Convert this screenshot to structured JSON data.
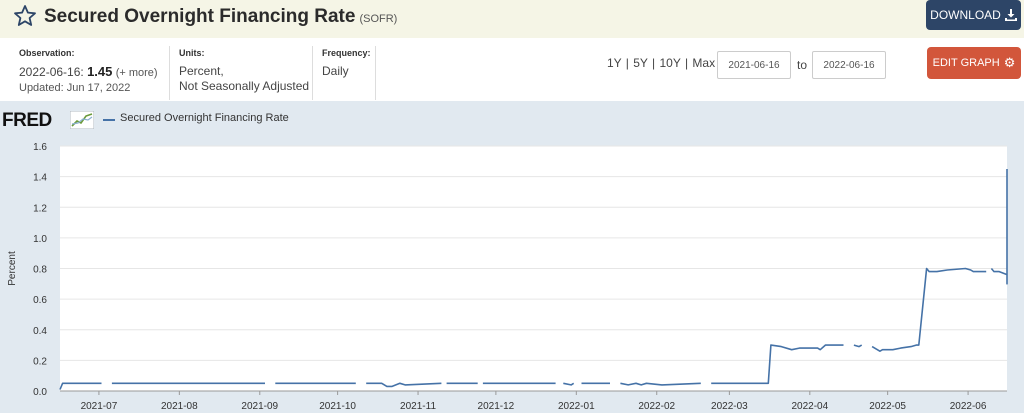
{
  "header": {
    "title": "Secured Overnight Financing Rate",
    "series_id": "(SOFR)",
    "download_label": "DOWNLOAD"
  },
  "info": {
    "observation_label": "Observation:",
    "observation_date": "2022-06-16:",
    "observation_value": "1.45",
    "observation_more": "(+ more)",
    "updated": "Updated: Jun 17, 2022",
    "units_label": "Units:",
    "units_line1": "Percent,",
    "units_line2": "Not Seasonally Adjusted",
    "frequency_label": "Frequency:",
    "frequency_value": "Daily"
  },
  "controls": {
    "ranges": "1Y | 5Y | 10Y | Max",
    "start_date": "2021-06-16",
    "to_label": "to",
    "end_date": "2022-06-16",
    "edit_label": "EDIT GRAPH"
  },
  "logo": {
    "text": "FRED"
  },
  "chart_data": {
    "type": "line",
    "legend": [
      "Secured Overnight Financing Rate"
    ],
    "ylabel": "Percent",
    "ylim": [
      0,
      1.6
    ],
    "yticks": [
      "0.0",
      "0.2",
      "0.4",
      "0.6",
      "0.8",
      "1.0",
      "1.2",
      "1.4",
      "1.6"
    ],
    "xlim": [
      "2021-06-16",
      "2022-06-16"
    ],
    "xticks": [
      {
        "date": "2021-07-01",
        "label": "2021-07"
      },
      {
        "date": "2021-08-01",
        "label": "2021-08"
      },
      {
        "date": "2021-09-01",
        "label": "2021-09"
      },
      {
        "date": "2021-10-01",
        "label": "2021-10"
      },
      {
        "date": "2021-11-01",
        "label": "2021-11"
      },
      {
        "date": "2021-12-01",
        "label": "2021-12"
      },
      {
        "date": "2022-01-01",
        "label": "2022-01"
      },
      {
        "date": "2022-02-01",
        "label": "2022-02"
      },
      {
        "date": "2022-03-01",
        "label": "2022-03"
      },
      {
        "date": "2022-04-01",
        "label": "2022-04"
      },
      {
        "date": "2022-05-01",
        "label": "2022-05"
      },
      {
        "date": "2022-06-01",
        "label": "2022-06"
      }
    ],
    "grid": true,
    "series_color": "#4572a7",
    "series": [
      {
        "name": "Secured Overnight Financing Rate",
        "segments": [
          [
            [
              "2021-06-16",
              0.01
            ],
            [
              "2021-06-17",
              0.05
            ],
            [
              "2021-07-02",
              0.05
            ]
          ],
          [
            [
              "2021-07-06",
              0.05
            ],
            [
              "2021-09-03",
              0.05
            ]
          ],
          [
            [
              "2021-09-07",
              0.05
            ],
            [
              "2021-10-08",
              0.05
            ]
          ],
          [
            [
              "2021-10-12",
              0.05
            ],
            [
              "2021-10-18",
              0.05
            ],
            [
              "2021-10-20",
              0.03
            ],
            [
              "2021-10-22",
              0.03
            ],
            [
              "2021-10-25",
              0.05
            ],
            [
              "2021-10-27",
              0.04
            ],
            [
              "2021-11-10",
              0.05
            ]
          ],
          [
            [
              "2021-11-12",
              0.05
            ],
            [
              "2021-11-24",
              0.05
            ]
          ],
          [
            [
              "2021-11-26",
              0.05
            ],
            [
              "2021-12-24",
              0.05
            ]
          ],
          [
            [
              "2021-12-27",
              0.05
            ],
            [
              "2021-12-30",
              0.04
            ],
            [
              "2021-12-31",
              0.05
            ]
          ],
          [
            [
              "2022-01-03",
              0.05
            ],
            [
              "2022-01-14",
              0.05
            ]
          ],
          [
            [
              "2022-01-18",
              0.05
            ],
            [
              "2022-01-21",
              0.04
            ],
            [
              "2022-01-24",
              0.05
            ],
            [
              "2022-01-26",
              0.04
            ],
            [
              "2022-01-28",
              0.05
            ],
            [
              "2022-02-03",
              0.04
            ],
            [
              "2022-02-18",
              0.05
            ]
          ],
          [
            [
              "2022-02-22",
              0.05
            ],
            [
              "2022-03-16",
              0.05
            ],
            [
              "2022-03-17",
              0.3
            ],
            [
              "2022-03-21",
              0.29
            ],
            [
              "2022-03-25",
              0.27
            ],
            [
              "2022-03-28",
              0.28
            ],
            [
              "2022-04-04",
              0.28
            ],
            [
              "2022-04-05",
              0.27
            ],
            [
              "2022-04-07",
              0.3
            ],
            [
              "2022-04-14",
              0.3
            ]
          ],
          [
            [
              "2022-04-18",
              0.3
            ],
            [
              "2022-04-20",
              0.29
            ],
            [
              "2022-04-21",
              0.3
            ]
          ],
          [
            [
              "2022-04-25",
              0.29
            ],
            [
              "2022-04-28",
              0.26
            ],
            [
              "2022-04-29",
              0.27
            ],
            [
              "2022-05-03",
              0.27
            ],
            [
              "2022-05-06",
              0.28
            ],
            [
              "2022-05-10",
              0.29
            ],
            [
              "2022-05-12",
              0.3
            ],
            [
              "2022-05-13",
              0.3
            ],
            [
              "2022-05-16",
              0.8
            ],
            [
              "2022-05-17",
              0.78
            ],
            [
              "2022-05-20",
              0.78
            ],
            [
              "2022-05-24",
              0.79
            ],
            [
              "2022-05-31",
              0.8
            ],
            [
              "2022-06-02",
              0.79
            ],
            [
              "2022-06-03",
              0.78
            ],
            [
              "2022-06-08",
              0.78
            ]
          ],
          [
            [
              "2022-06-10",
              0.8
            ],
            [
              "2022-06-11",
              0.78
            ],
            [
              "2022-06-13",
              0.78
            ],
            [
              "2022-06-16",
              0.76
            ],
            [
              "2022-06-20",
              0.75
            ],
            [
              "2022-06-22",
              0.73
            ],
            [
              "2022-06-23",
              0.7
            ],
            [
              "2022-06-24",
              0.7
            ],
            [
              "2022-06-25",
              1.45
            ]
          ]
        ]
      }
    ]
  }
}
